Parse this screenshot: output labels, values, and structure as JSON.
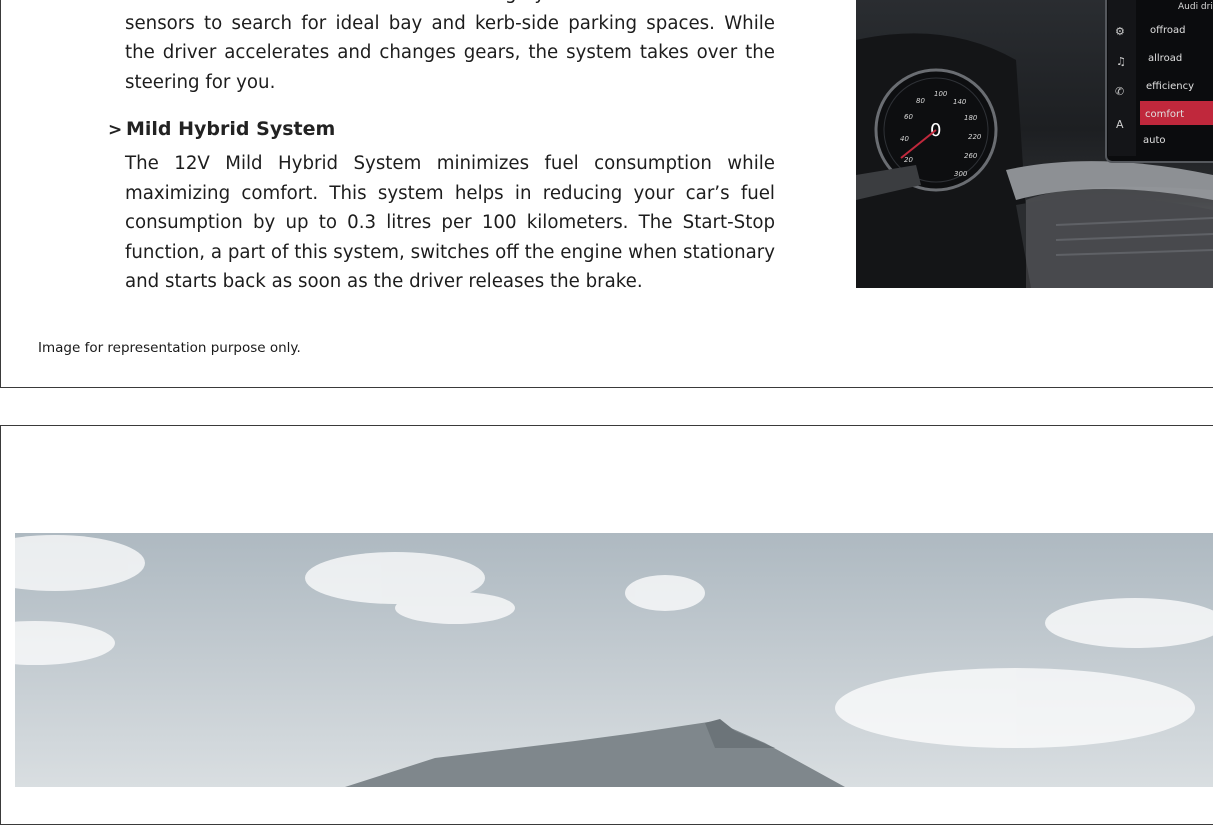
{
  "top_section": {
    "parking_paragraph": "Assist. It works in tandem with the Parking System and uses ultrasonic sensors to search for ideal bay and kerb-side parking spaces. While the driver accelerates and changes gears, the system takes over the steering for you.",
    "feature_heading": "Mild Hybrid System",
    "feature_chevron": ">",
    "hybrid_paragraph": "The 12V Mild Hybrid System minimizes fuel consumption while maximizing comfort. This system helps in reducing your car’s fuel consumption by up to 0.3 litres per 100 kilometers. The Start-Stop function, a part of this system, switches off the engine when stationary and starts back as soon as the driver releases the brake.",
    "disclaimer": "Image for representation purpose only."
  },
  "dashboard_image": {
    "speedometer_ticks": [
      "20",
      "40",
      "60",
      "80",
      "100",
      "140",
      "180",
      "220",
      "260",
      "300"
    ],
    "speed_value": "0",
    "drive_menu_header": "Audi dri",
    "drive_modes": [
      "offroad",
      "allroad",
      "efficiency",
      "comfort",
      "auto"
    ],
    "selected_mode": "comfort",
    "accent_color": "#c0283c"
  }
}
